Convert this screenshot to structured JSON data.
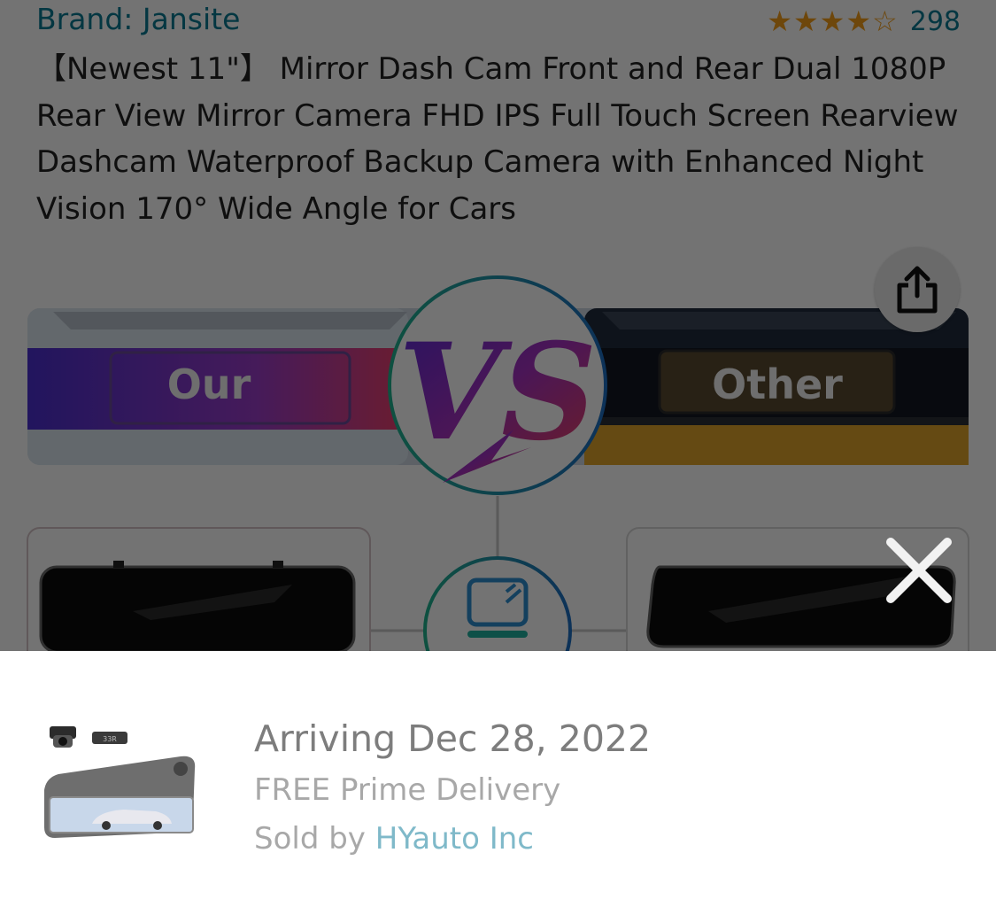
{
  "product": {
    "brand": "Brand: Jansite",
    "rating_value": 4.5,
    "rating_count": "298",
    "title": "【Newest 11\"】 Mirror Dash Cam Front and Rear Dual 1080P Rear View Mirror Camera FHD IPS Full Touch Screen Rearview Dashcam Waterproof Backup Camera with Enhanced Night Vision 170° Wide Angle for Cars"
  },
  "image": {
    "left_label": "Our",
    "right_label": "Other",
    "center_label": "VS"
  },
  "actions": {
    "share_icon": "share-icon",
    "close_icon": "close-icon"
  },
  "delivery": {
    "arriving": "Arriving Dec 28, 2022",
    "shipping": "FREE Prime Delivery",
    "sold_by_prefix": "Sold by",
    "seller": "HYauto Inc"
  },
  "colors": {
    "link": "#0b7a93",
    "star": "#f49d19",
    "overlay": "rgba(0,0,0,0.55)"
  }
}
